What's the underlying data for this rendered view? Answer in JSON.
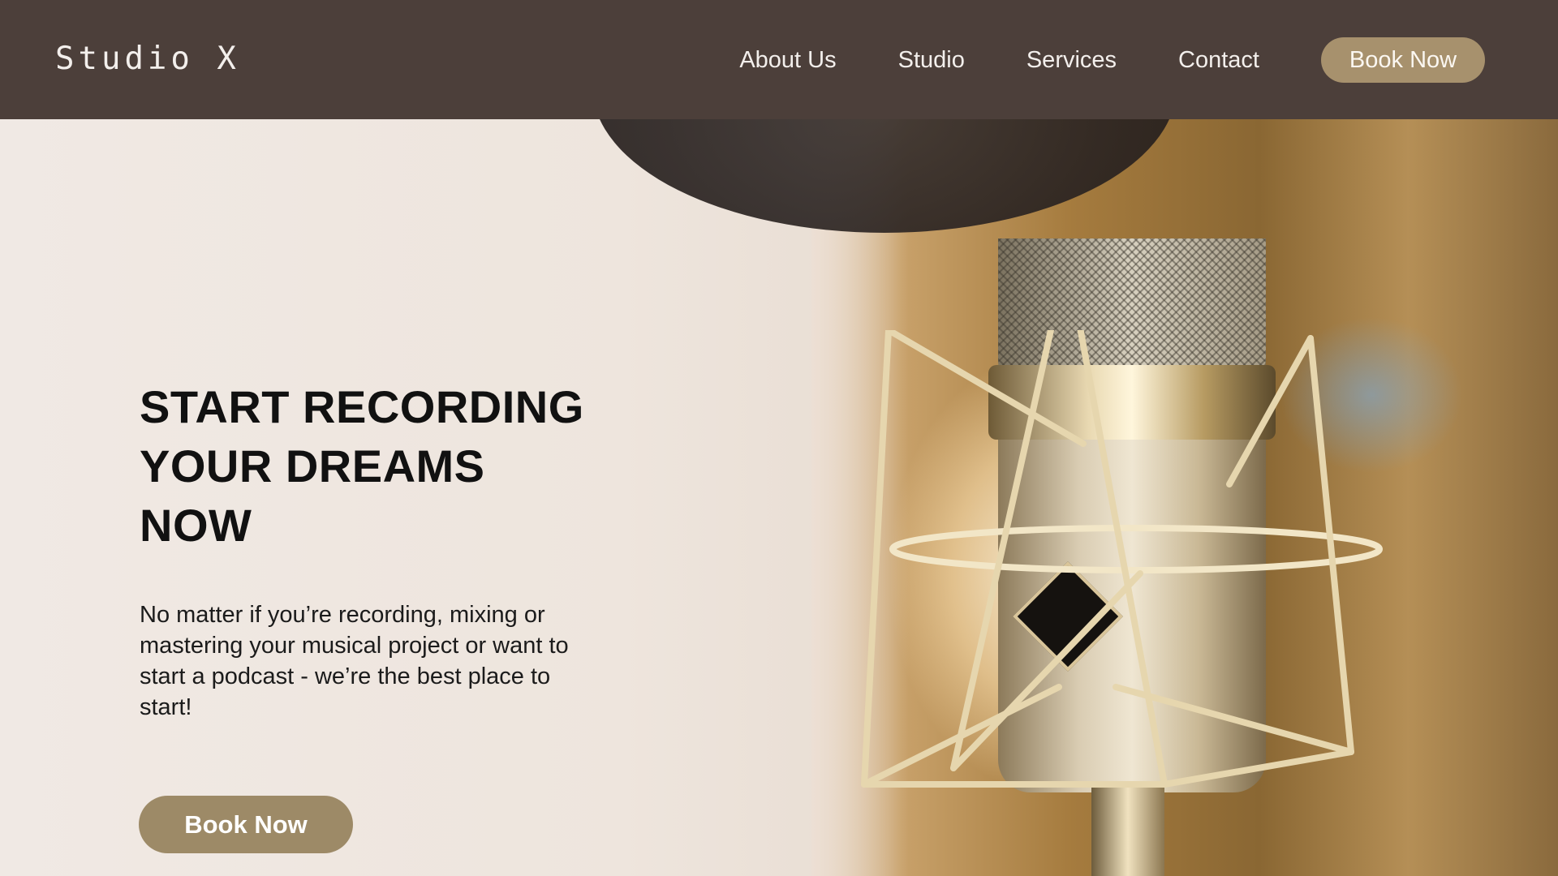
{
  "header": {
    "logo": "Studio X",
    "nav": {
      "about": "About Us",
      "studio": "Studio",
      "services": "Services",
      "contact": "Contact",
      "cta": "Book Now"
    }
  },
  "hero": {
    "headline_line1": "START RECORDING",
    "headline_line2": "YOUR DREAMS",
    "headline_line3": "NOW",
    "subtext": "No matter if you’re recording, mixing or mastering your musical project or want to start a podcast - we’re the best place to start!",
    "cta": "Book Now",
    "image_subject": "studio-condenser-microphone"
  },
  "colors": {
    "header_bg": "#4c3f3a",
    "accent": "#a7916d",
    "hero_bg": "#efe8e2"
  }
}
